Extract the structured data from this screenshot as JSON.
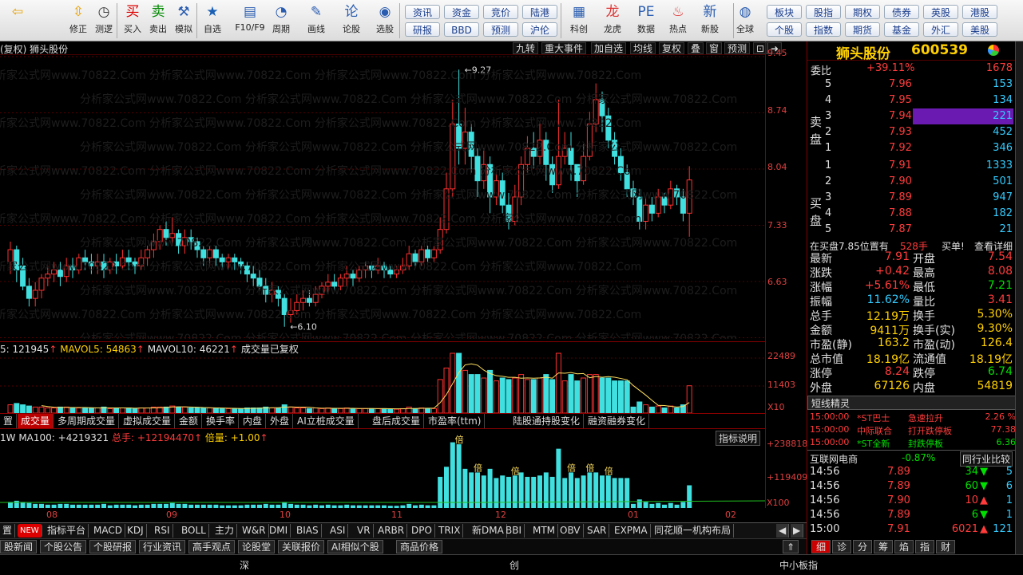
{
  "toolbar": {
    "left": [
      {
        "label": "",
        "icon": "back-arrow-icon"
      },
      {
        "label": "修正",
        "icon": "arrows-updown-icon"
      },
      {
        "label": "测逻",
        "icon": "clock-icon"
      },
      {
        "label": "买入",
        "icon": "buy-icon"
      },
      {
        "label": "卖出",
        "icon": "sell-icon"
      },
      {
        "label": "模拟",
        "icon": "hammer-icon"
      },
      {
        "label": "自选",
        "icon": "star-icon"
      },
      {
        "label": "F10/F9",
        "icon": "f10-icon"
      },
      {
        "label": "周期",
        "icon": "period-icon"
      },
      {
        "label": "画线",
        "icon": "pen-icon"
      },
      {
        "label": "论股",
        "icon": "lungu-icon"
      },
      {
        "label": "选股",
        "icon": "select-icon"
      }
    ],
    "pills_top": [
      "资讯",
      "资金",
      "竞价",
      "陆港"
    ],
    "pills_bottom": [
      "研报",
      "BBD",
      "预测",
      "沪伦"
    ],
    "right": [
      {
        "label": "科创",
        "icon": "chart-icon"
      },
      {
        "label": "龙虎",
        "icon": "dragon-icon"
      },
      {
        "label": "数据",
        "icon": "pe-icon"
      },
      {
        "label": "热点",
        "icon": "fire-icon"
      },
      {
        "label": "新股",
        "icon": "newstock-icon"
      },
      {
        "label": "全球",
        "icon": "globe-icon"
      }
    ],
    "pills2_top": [
      "板块",
      "股指",
      "期权",
      "债券",
      "英股",
      "港股"
    ],
    "pills2_bottom": [
      "个股",
      "指数",
      "期货",
      "基金",
      "外汇",
      "美股"
    ]
  },
  "chart_header": {
    "title": "(复权) 狮头股份",
    "buttons": [
      "九转",
      "重大事件",
      "加自选",
      "均线",
      "复权",
      "叠",
      "窗",
      "预测"
    ]
  },
  "price_axis": [
    "9.45",
    "8.74",
    "8.04",
    "7.33",
    "6.63"
  ],
  "annotations": {
    "high": "9.27",
    "low": "6.10"
  },
  "volume": {
    "legend_vol": "5: 121945",
    "legend_ma5": "MAVOL5: 54863",
    "legend_ma10": "MAVOL10: 46221",
    "legend_note": "成交量已复权",
    "axis": [
      "22489",
      "11403",
      "X10"
    ]
  },
  "vol_tabs": [
    "置",
    "成交量",
    "多周期成交量",
    "虚拟成交量",
    "金额",
    "换手率",
    "内盘",
    "外盘",
    "AI立桩成交量",
    "盘后成交量",
    "市盈率(ttm)",
    "陆股通持股变化",
    "融资融券变化"
  ],
  "indicator": {
    "legend": "1W MA100: +4219321",
    "legend_total": "总手: +12194470",
    "legend_mult": "倍量: +1.00",
    "button": "指标说明",
    "axis": [
      "+238818",
      "+119409",
      "X100"
    ],
    "mark": "倍"
  },
  "months": [
    "08",
    "09",
    "10",
    "11",
    "12",
    "01",
    "02"
  ],
  "indicator_tabs": [
    "置",
    "NEW",
    "指标平台",
    "MACD",
    "KDJ",
    "RSI",
    "BOLL",
    "主力",
    "W&R",
    "DMI",
    "BIAS",
    "ASI",
    "VR",
    "ARBR",
    "DPO",
    "TRIX",
    "新DMA",
    "BBI",
    "MTM",
    "OBV",
    "SAR",
    "EXPMA",
    "同花顺一机构布局"
  ],
  "news_tabs": [
    "股新闻",
    "个股公告",
    "个股研报",
    "行业资讯",
    "高手观点",
    "论股堂",
    "关联报价",
    "AI相似个股",
    "商品价格"
  ],
  "status": {
    "left": "深",
    "mid": "创",
    "right": "中小板指"
  },
  "watermark": "分析家公式网www.70822.Com",
  "quote": {
    "name": "狮头股份",
    "code": "600539",
    "weibi_label": "委比",
    "weibi": "+39.11%",
    "weicha": "1678",
    "sell_label": "卖盘",
    "buy_label": "买盘",
    "asks": [
      {
        "n": "5",
        "p": "7.96",
        "v": "153"
      },
      {
        "n": "4",
        "p": "7.95",
        "v": "134"
      },
      {
        "n": "3",
        "p": "7.94",
        "v": "221"
      },
      {
        "n": "2",
        "p": "7.93",
        "v": "452"
      },
      {
        "n": "1",
        "p": "7.92",
        "v": "346"
      }
    ],
    "bids": [
      {
        "n": "1",
        "p": "7.91",
        "v": "1333"
      },
      {
        "n": "2",
        "p": "7.90",
        "v": "501"
      },
      {
        "n": "3",
        "p": "7.89",
        "v": "947"
      },
      {
        "n": "4",
        "p": "7.88",
        "v": "182"
      },
      {
        "n": "5",
        "p": "7.87",
        "v": "21"
      }
    ],
    "notice": "在买盘7.85位置有",
    "notice_vol": "528手",
    "notice_tag": "买单!",
    "notice_link": "查看详细",
    "stats": [
      {
        "l1": "最新",
        "v1": "7.91",
        "l2": "开盘",
        "v2": "7.54"
      },
      {
        "l1": "涨跌",
        "v1": "+0.42",
        "l2": "最高",
        "v2": "8.08"
      },
      {
        "l1": "涨幅",
        "v1": "+5.61%",
        "l2": "最低",
        "v2": "7.21"
      },
      {
        "l1": "振幅",
        "v1": "11.62%",
        "l2": "量比",
        "v2": "3.41"
      },
      {
        "l1": "总手",
        "v1": "12.19万",
        "l2": "换手",
        "v2": "5.30%"
      },
      {
        "l1": "金额",
        "v1": "9411万",
        "l2": "换手(实)",
        "v2": "9.30%"
      },
      {
        "l1": "市盈(静)",
        "v1": "163.2",
        "l2": "市盈(动)",
        "v2": "126.4"
      },
      {
        "l1": "总市值",
        "v1": "18.19亿",
        "l2": "流通值",
        "v2": "18.19亿"
      },
      {
        "l1": "涨停",
        "v1": "8.24",
        "l2": "跌停",
        "v2": "6.74"
      },
      {
        "l1": "外盘",
        "v1": "67126",
        "l2": "内盘",
        "v2": "54819"
      }
    ],
    "sprite_title": "短线精灵",
    "sprite": [
      {
        "t": "15:00:00",
        "s": "*ST巴士",
        "e": "急速拉升",
        "v": "2.26 %"
      },
      {
        "t": "15:00:00",
        "s": "中际联合",
        "e": "打开跌停板",
        "v": "77.38"
      },
      {
        "t": "15:00:00",
        "s": "*ST全新",
        "e": "封跌停板",
        "v": "6.36"
      }
    ],
    "industry": {
      "name": "互联网电商",
      "chg": "-0.87%",
      "btn": "同行业比较"
    },
    "ticks": [
      {
        "t": "14:56",
        "p": "7.89",
        "v": "34",
        "d": "down",
        "n": "5"
      },
      {
        "t": "14:56",
        "p": "7.89",
        "v": "60",
        "d": "down",
        "n": "6"
      },
      {
        "t": "14:56",
        "p": "7.90",
        "v": "10",
        "d": "up",
        "n": "1"
      },
      {
        "t": "14:56",
        "p": "7.89",
        "v": "6",
        "d": "down",
        "n": "1"
      },
      {
        "t": "15:00",
        "p": "7.91",
        "v": "6021",
        "d": "up",
        "n": "121"
      }
    ],
    "detail_tabs": [
      "细",
      "诊",
      "分",
      "筹",
      "焰",
      "指",
      "财"
    ]
  },
  "chart_data": {
    "type": "candlestick",
    "ylim": [
      5.95,
      9.45
    ],
    "x_ticks": [
      "08",
      "09",
      "10",
      "11",
      "12",
      "01",
      "02"
    ],
    "candles": [
      [
        6.9,
        7.05,
        6.75,
        7.15
      ],
      [
        7.05,
        6.8,
        6.65,
        7.1
      ],
      [
        6.85,
        6.6,
        6.55,
        6.95
      ],
      [
        6.6,
        6.45,
        6.35,
        6.7
      ],
      [
        6.45,
        6.55,
        6.35,
        6.65
      ],
      [
        6.55,
        6.7,
        6.45,
        6.75
      ],
      [
        6.7,
        6.75,
        6.6,
        6.85
      ],
      [
        6.75,
        6.8,
        6.65,
        6.9
      ],
      [
        6.8,
        6.72,
        6.6,
        6.9
      ],
      [
        6.72,
        6.85,
        6.65,
        6.95
      ],
      [
        6.85,
        6.8,
        6.7,
        6.95
      ],
      [
        6.8,
        6.95,
        6.75,
        7.0
      ],
      [
        6.95,
        6.9,
        6.8,
        7.05
      ],
      [
        6.9,
        6.85,
        6.75,
        7.0
      ],
      [
        6.85,
        6.9,
        6.75,
        7.0
      ],
      [
        6.9,
        6.8,
        6.7,
        7.0
      ],
      [
        6.8,
        6.9,
        6.75,
        6.95
      ],
      [
        6.9,
        6.85,
        6.75,
        7.0
      ],
      [
        6.85,
        6.95,
        6.8,
        7.05
      ],
      [
        6.95,
        6.9,
        6.8,
        7.05
      ],
      [
        6.9,
        6.85,
        6.75,
        6.95
      ],
      [
        6.85,
        6.95,
        6.8,
        7.05
      ],
      [
        6.95,
        7.05,
        6.85,
        7.1
      ],
      [
        7.05,
        7.15,
        6.95,
        7.25
      ],
      [
        7.15,
        7.3,
        7.05,
        7.35
      ],
      [
        7.3,
        7.2,
        7.1,
        7.4
      ],
      [
        7.2,
        7.25,
        7.1,
        7.45
      ],
      [
        7.25,
        7.1,
        7.0,
        7.3
      ],
      [
        7.1,
        7.2,
        7.0,
        7.3
      ],
      [
        7.2,
        7.15,
        7.05,
        7.3
      ],
      [
        7.15,
        7.05,
        6.95,
        7.2
      ],
      [
        7.05,
        6.95,
        6.85,
        7.1
      ],
      [
        6.95,
        7.05,
        6.85,
        7.1
      ],
      [
        7.05,
        6.95,
        6.85,
        7.1
      ],
      [
        6.95,
        6.9,
        6.8,
        7.0
      ],
      [
        6.9,
        6.95,
        6.8,
        7.0
      ],
      [
        6.95,
        6.9,
        6.8,
        7.0
      ],
      [
        6.9,
        6.85,
        6.75,
        6.95
      ],
      [
        6.85,
        6.75,
        6.65,
        6.9
      ],
      [
        6.75,
        6.7,
        6.6,
        6.85
      ],
      [
        6.7,
        6.6,
        6.55,
        6.8
      ],
      [
        6.6,
        6.5,
        6.4,
        6.7
      ],
      [
        6.5,
        6.55,
        6.4,
        6.65
      ],
      [
        6.55,
        6.45,
        6.35,
        6.6
      ],
      [
        6.45,
        6.25,
        6.1,
        6.5
      ],
      [
        6.25,
        6.3,
        6.15,
        6.45
      ],
      [
        6.3,
        6.4,
        6.25,
        6.5
      ],
      [
        6.4,
        6.45,
        6.3,
        6.55
      ],
      [
        6.45,
        6.4,
        6.35,
        6.55
      ],
      [
        6.4,
        6.5,
        6.35,
        6.6
      ],
      [
        6.5,
        6.6,
        6.45,
        6.65
      ],
      [
        6.6,
        6.65,
        6.5,
        6.75
      ],
      [
        6.65,
        6.6,
        6.55,
        6.75
      ],
      [
        6.6,
        6.7,
        6.55,
        6.75
      ],
      [
        6.7,
        6.75,
        6.6,
        6.85
      ],
      [
        6.75,
        6.7,
        6.6,
        6.8
      ],
      [
        6.7,
        6.8,
        6.65,
        6.85
      ],
      [
        6.8,
        6.85,
        6.7,
        6.9
      ],
      [
        6.85,
        6.8,
        6.7,
        6.9
      ],
      [
        6.8,
        6.85,
        6.75,
        6.95
      ],
      [
        6.85,
        6.8,
        6.7,
        6.9
      ],
      [
        6.8,
        6.75,
        6.7,
        6.85
      ],
      [
        6.75,
        6.8,
        6.7,
        6.85
      ],
      [
        6.8,
        6.85,
        6.75,
        6.95
      ],
      [
        6.85,
        7.0,
        6.8,
        7.1
      ],
      [
        7.0,
        6.9,
        6.85,
        7.05
      ],
      [
        6.9,
        7.05,
        6.85,
        7.1
      ],
      [
        7.05,
        6.95,
        6.9,
        7.1
      ],
      [
        6.95,
        7.05,
        6.9,
        7.1
      ],
      [
        7.05,
        7.3,
        7.0,
        7.45
      ],
      [
        7.3,
        7.8,
        7.25,
        8.0
      ],
      [
        7.8,
        8.6,
        7.7,
        8.9
      ],
      [
        8.6,
        8.3,
        8.1,
        9.27
      ],
      [
        8.3,
        8.5,
        8.1,
        8.8
      ],
      [
        8.5,
        8.2,
        8.0,
        8.6
      ],
      [
        8.2,
        7.9,
        7.7,
        8.3
      ],
      [
        7.9,
        8.1,
        7.8,
        8.3
      ],
      [
        8.1,
        7.7,
        7.5,
        8.2
      ],
      [
        7.7,
        7.9,
        7.6,
        8.0
      ],
      [
        7.9,
        7.6,
        7.5,
        8.0
      ],
      [
        7.6,
        7.4,
        7.3,
        7.75
      ],
      [
        7.4,
        7.7,
        7.35,
        7.85
      ],
      [
        7.7,
        8.1,
        7.6,
        8.2
      ],
      [
        8.1,
        8.3,
        8.0,
        8.45
      ],
      [
        8.3,
        8.2,
        8.05,
        8.5
      ],
      [
        8.2,
        8.4,
        8.1,
        8.6
      ],
      [
        8.4,
        8.1,
        7.9,
        8.5
      ],
      [
        8.1,
        7.85,
        7.75,
        8.2
      ],
      [
        7.85,
        8.2,
        7.8,
        8.9
      ],
      [
        8.2,
        8.3,
        8.1,
        8.5
      ],
      [
        8.3,
        8.1,
        7.9,
        8.5
      ],
      [
        8.1,
        7.9,
        7.7,
        8.1
      ],
      [
        7.9,
        8.2,
        7.85,
        8.35
      ],
      [
        8.2,
        8.6,
        8.15,
        8.75
      ],
      [
        8.6,
        8.9,
        8.5,
        9.1
      ],
      [
        8.9,
        8.7,
        8.5,
        9.0
      ],
      [
        8.7,
        8.4,
        8.3,
        8.8
      ],
      [
        8.4,
        8.2,
        8.1,
        8.5
      ],
      [
        8.2,
        8.0,
        7.9,
        8.3
      ],
      [
        8.0,
        7.8,
        7.7,
        8.1
      ],
      [
        7.8,
        7.7,
        7.6,
        7.9
      ],
      [
        7.7,
        7.4,
        7.3,
        7.8
      ],
      [
        7.4,
        7.6,
        7.3,
        7.7
      ],
      [
        7.6,
        7.5,
        7.4,
        7.7
      ],
      [
        7.5,
        7.7,
        7.45,
        7.8
      ],
      [
        7.7,
        7.6,
        7.5,
        7.75
      ],
      [
        7.6,
        7.8,
        7.55,
        7.9
      ],
      [
        7.8,
        7.7,
        7.6,
        7.85
      ],
      [
        7.7,
        7.5,
        7.4,
        7.8
      ],
      [
        7.5,
        7.91,
        7.21,
        8.08
      ]
    ]
  }
}
